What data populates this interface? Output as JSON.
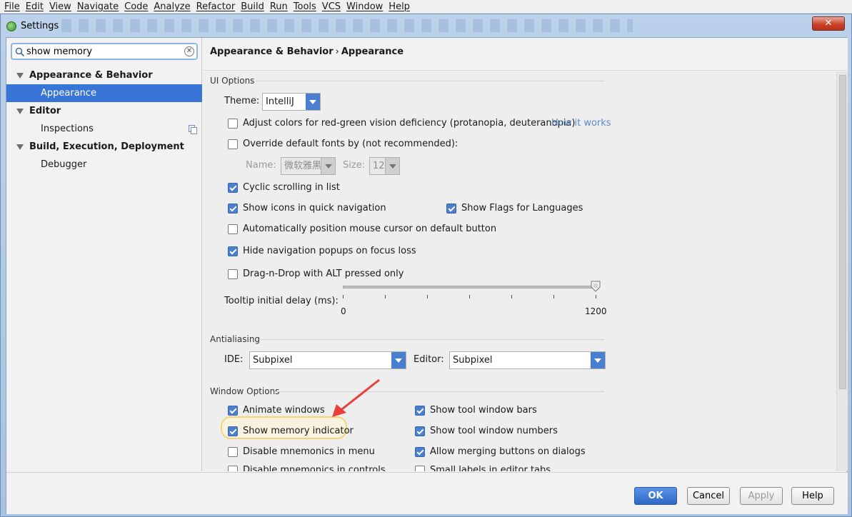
{
  "menu": [
    "File",
    "Edit",
    "View",
    "Navigate",
    "Code",
    "Analyze",
    "Refactor",
    "Build",
    "Run",
    "Tools",
    "VCS",
    "Window",
    "Help"
  ],
  "window": {
    "title": "Settings",
    "close_glyph": "✕"
  },
  "search": {
    "value": "show memory",
    "clear_glyph": "✕"
  },
  "tree": [
    {
      "label": "Appearance & Behavior",
      "kind": "category"
    },
    {
      "label": "Appearance",
      "kind": "leaf",
      "selected": true
    },
    {
      "label": "Editor",
      "kind": "category"
    },
    {
      "label": "Inspections",
      "kind": "leaf"
    },
    {
      "label": "Build, Execution, Deployment",
      "kind": "category"
    },
    {
      "label": "Debugger",
      "kind": "leaf"
    }
  ],
  "breadcrumb": {
    "part1": "Appearance & Behavior",
    "sep": "›",
    "part2": "Appearance"
  },
  "ui_options": {
    "title": "UI Options",
    "theme_label": "Theme:",
    "theme_value": "IntelliJ",
    "adjust_colors": "Adjust colors for red-green vision deficiency (protanopia, deuteranopia)",
    "how_it_works": "How it works",
    "override_fonts": "Override default fonts by (not recommended):",
    "name_label": "Name:",
    "name_value": "微软雅黑",
    "size_label": "Size:",
    "size_value": "12",
    "cyclic_scrolling": "Cyclic scrolling in list",
    "show_icons": "Show icons in quick navigation",
    "show_flags": "Show Flags for Languages",
    "auto_position": "Automatically position mouse cursor on default button",
    "hide_nav": "Hide navigation popups on focus loss",
    "drag_drop": "Drag-n-Drop with ALT pressed only",
    "tooltip_label": "Tooltip initial delay (ms):",
    "tooltip_min": "0",
    "tooltip_max": "1200",
    "tooltip_value": 1200
  },
  "antialiasing": {
    "title": "Antialiasing",
    "ide_label": "IDE:",
    "ide_value": "Subpixel",
    "editor_label": "Editor:",
    "editor_value": "Subpixel"
  },
  "window_options": {
    "title": "Window Options",
    "animate_windows": "Animate windows",
    "show_memory": "Show memory indicator",
    "disable_mnemonics_menu": "Disable mnemonics in menu",
    "disable_mnemonics_controls": "Disable mnemonics in controls",
    "show_tool_bars": "Show tool window bars",
    "show_tool_numbers": "Show tool window numbers",
    "allow_merging": "Allow merging buttons on dialogs",
    "small_labels": "Small labels in editor tabs"
  },
  "buttons": {
    "ok": "OK",
    "cancel": "Cancel",
    "apply": "Apply",
    "help": "Help"
  },
  "colors": {
    "accent": "#3875d7",
    "annotation_arrow": "#e8403a",
    "highlight": "#f2d47a"
  }
}
